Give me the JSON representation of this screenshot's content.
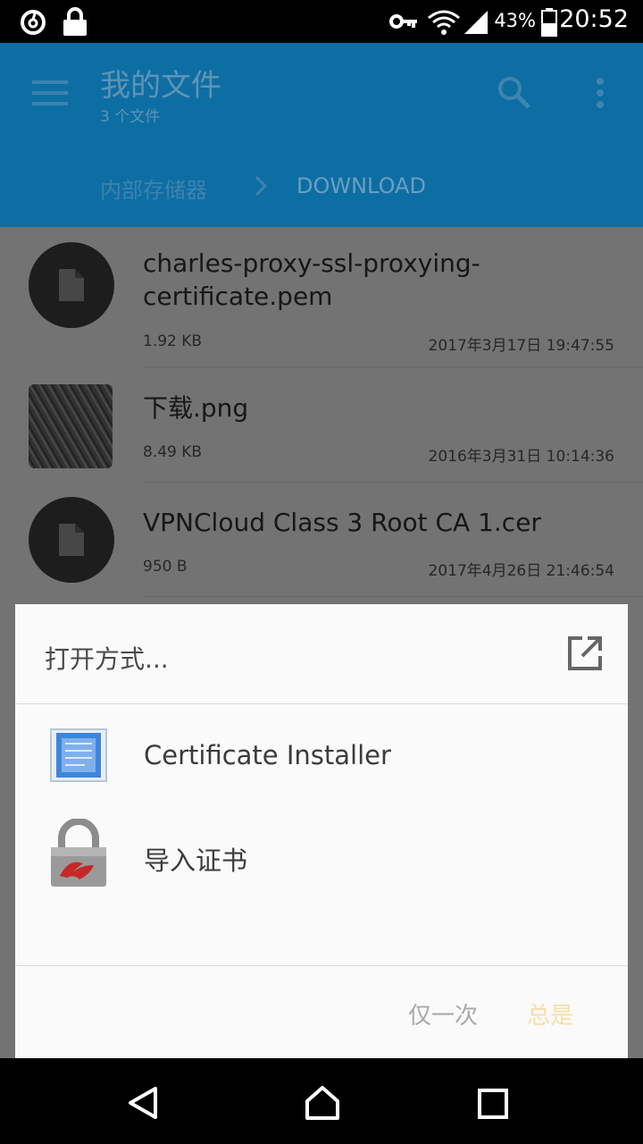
{
  "status_bar": {
    "battery_percent": "43%",
    "time": "20:52"
  },
  "app_bar": {
    "title": "我的文件",
    "subtitle": "3 个文件",
    "breadcrumb": [
      "内部存储器",
      "DOWNLOAD"
    ]
  },
  "files": [
    {
      "name": "charles-proxy-ssl-proxying-certificate.pem",
      "size": "1.92 KB",
      "date": "2017年3月17日 19:47:55",
      "icon": "file-icon"
    },
    {
      "name": "下载.png",
      "size": "8.49 KB",
      "date": "2016年3月31日 10:14:36",
      "icon": "image-thumbnail"
    },
    {
      "name": "VPNCloud Class 3 Root CA 1.cer",
      "size": "950 B",
      "date": "2017年4月26日 21:46:54",
      "icon": "file-icon"
    }
  ],
  "dialog": {
    "title": "打开方式...",
    "apps": [
      {
        "label": "Certificate Installer",
        "icon": "certificate-installer-icon"
      },
      {
        "label": "导入证书",
        "icon": "lock-import-icon"
      }
    ],
    "just_once_label": "仅一次",
    "always_label": "总是"
  },
  "colors": {
    "app_bar": "#0d6ea4",
    "accent_disabled": "#f9dca4",
    "dialog_bg": "#fafafa"
  }
}
